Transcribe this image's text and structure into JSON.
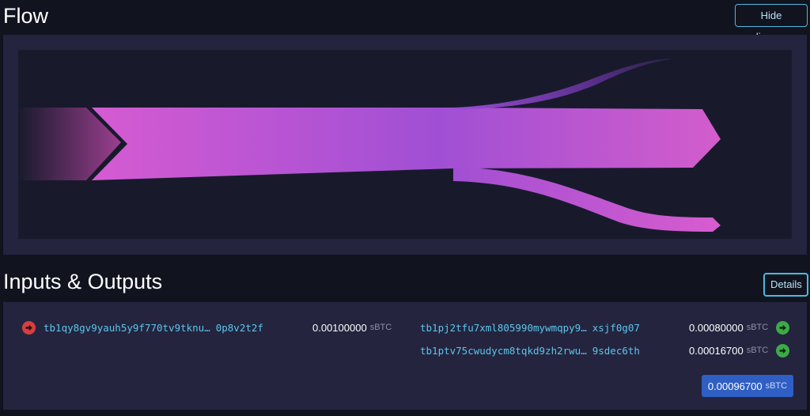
{
  "flow": {
    "title": "Flow",
    "hide_diagram_label": "Hide diagram"
  },
  "io": {
    "title": "Inputs & Outputs",
    "details_label": "Details",
    "inputs": [
      {
        "address_start": "tb1qy8gv9yauh5y9f770tv9tknu…",
        "address_end": "0p8v2t2f",
        "amount": "0.00100000",
        "unit": "sBTC",
        "icon": "arrow-right-circle-icon"
      }
    ],
    "outputs": [
      {
        "address_start": "tb1pj2tfu7xml805990mywmqpy9…",
        "address_end": "xsjf0g07",
        "amount": "0.00080000",
        "unit": "sBTC",
        "icon": "arrow-right-circle-icon"
      },
      {
        "address_start": "tb1ptv75cwudycm8tqkd9zh2rwu…",
        "address_end": "9sdec6th",
        "amount": "0.00016700",
        "unit": "sBTC",
        "icon": "arrow-right-circle-icon"
      }
    ],
    "total": {
      "amount": "0.00096700",
      "unit": "sBTC"
    }
  },
  "colors": {
    "background": "#11131f",
    "panel": "#24243f",
    "diagram_bg": "#181a2c",
    "flow_pink": "#d35fd0",
    "flow_purple": "#a24fd3",
    "accent_link": "#5cc6ea",
    "input_arrow": "#d63f3f",
    "output_arrow": "#3daa47",
    "total_badge": "#2f5fc4"
  }
}
